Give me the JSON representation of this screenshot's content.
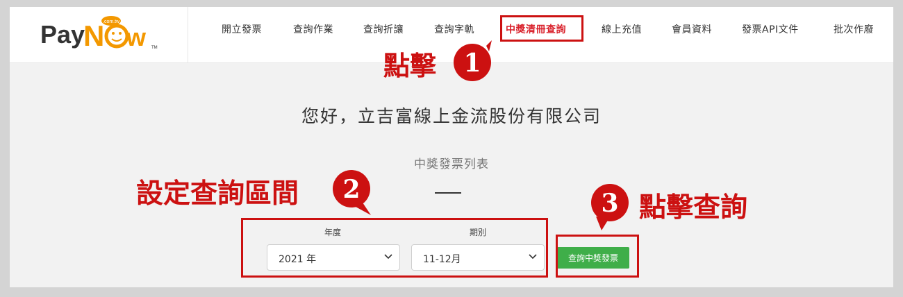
{
  "logo": {
    "text_pay": "Pay",
    "text_n": "N",
    "text_w": "w",
    "badge": ".com.tw",
    "tm": "TM"
  },
  "nav": [
    {
      "label": "開立發票",
      "active": false
    },
    {
      "label": "查詢作業",
      "active": false
    },
    {
      "label": "查詢折讓",
      "active": false
    },
    {
      "label": "查詢字軌",
      "active": false
    },
    {
      "label": "中獎清冊查詢",
      "active": true
    },
    {
      "label": "線上充值",
      "active": false
    },
    {
      "label": "會員資料",
      "active": false
    },
    {
      "label": "發票API文件",
      "active": false
    },
    {
      "label": "批次作廢",
      "active": false
    }
  ],
  "greeting": "您好，立吉富線上金流股份有限公司",
  "subtitle": "中獎發票列表",
  "form": {
    "year_label": "年度",
    "year_value": "2021 年",
    "period_label": "期別",
    "period_value": "11-12月",
    "query_button": "查詢中獎發票"
  },
  "annotations": {
    "step1_text": "點擊",
    "step1_num": "1",
    "step2_text": "設定查詢區間",
    "step2_num": "2",
    "step3_text": "點擊查詢",
    "step3_num": "3"
  },
  "colors": {
    "accent": "#cc1111",
    "button": "#3fae49",
    "logo_orange": "#f39800",
    "logo_gray": "#333333"
  }
}
